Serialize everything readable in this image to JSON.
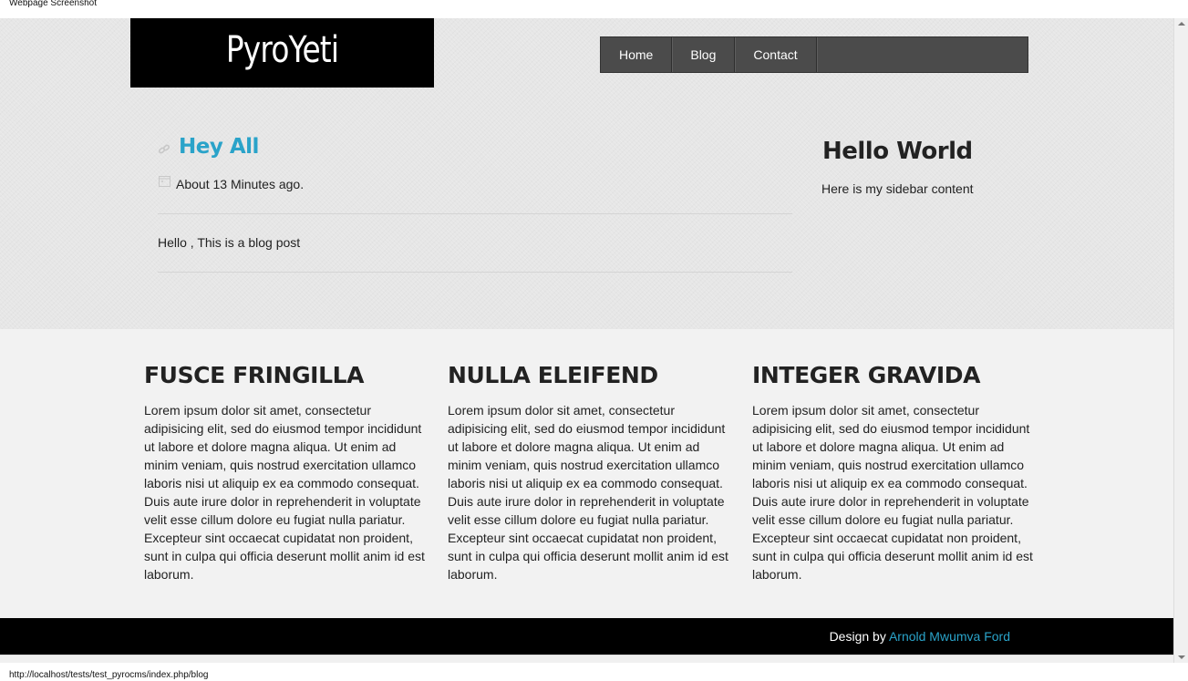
{
  "window": {
    "title": "Webpage Screenshot"
  },
  "header": {
    "logo": "PyroYeti",
    "nav": [
      "Home",
      "Blog",
      "Contact"
    ]
  },
  "post": {
    "title": "Hey All",
    "date": "About 13 Minutes ago.",
    "body": "Hello , This is a blog post"
  },
  "sidebar": {
    "title": "Hello World",
    "text": "Here is my sidebar content"
  },
  "columns": [
    {
      "heading": "FUSCE FRINGILLA",
      "text": "Lorem ipsum dolor sit amet, consectetur adipisicing elit, sed do eiusmod tempor incididunt ut labore et dolore magna aliqua. Ut enim ad minim veniam, quis nostrud exercitation ullamco laboris nisi ut aliquip ex ea commodo consequat. Duis aute irure dolor in reprehenderit in voluptate velit esse cillum dolore eu fugiat nulla pariatur. Excepteur sint occaecat cupidatat non proident, sunt in culpa qui officia deserunt mollit anim id est laborum."
    },
    {
      "heading": "NULLA ELEIFEND",
      "text": "Lorem ipsum dolor sit amet, consectetur adipisicing elit, sed do eiusmod tempor incididunt ut labore et dolore magna aliqua. Ut enim ad minim veniam, quis nostrud exercitation ullamco laboris nisi ut aliquip ex ea commodo consequat. Duis aute irure dolor in reprehenderit in voluptate velit esse cillum dolore eu fugiat nulla pariatur. Excepteur sint occaecat cupidatat non proident, sunt in culpa qui officia deserunt mollit anim id est laborum."
    },
    {
      "heading": "INTEGER GRAVIDA",
      "text": "Lorem ipsum dolor sit amet, consectetur adipisicing elit, sed do eiusmod tempor incididunt ut labore et dolore magna aliqua. Ut enim ad minim veniam, quis nostrud exercitation ullamco laboris nisi ut aliquip ex ea commodo consequat. Duis aute irure dolor in reprehenderit in voluptate velit esse cillum dolore eu fugiat nulla pariatur. Excepteur sint occaecat cupidatat non proident, sunt in culpa qui officia deserunt mollit anim id est laborum."
    }
  ],
  "footer": {
    "prefix": "Design by",
    "author": "Arnold Mwumva Ford"
  },
  "status": {
    "url": "http://localhost/tests/test_pyrocms/index.php/blog"
  },
  "colors": {
    "accent": "#2aa3c9",
    "nav_bg": "#4b4b4b",
    "footer_bg": "#000000"
  },
  "icons": {
    "title_icon": "link-icon",
    "date_icon": "calendar-icon"
  }
}
